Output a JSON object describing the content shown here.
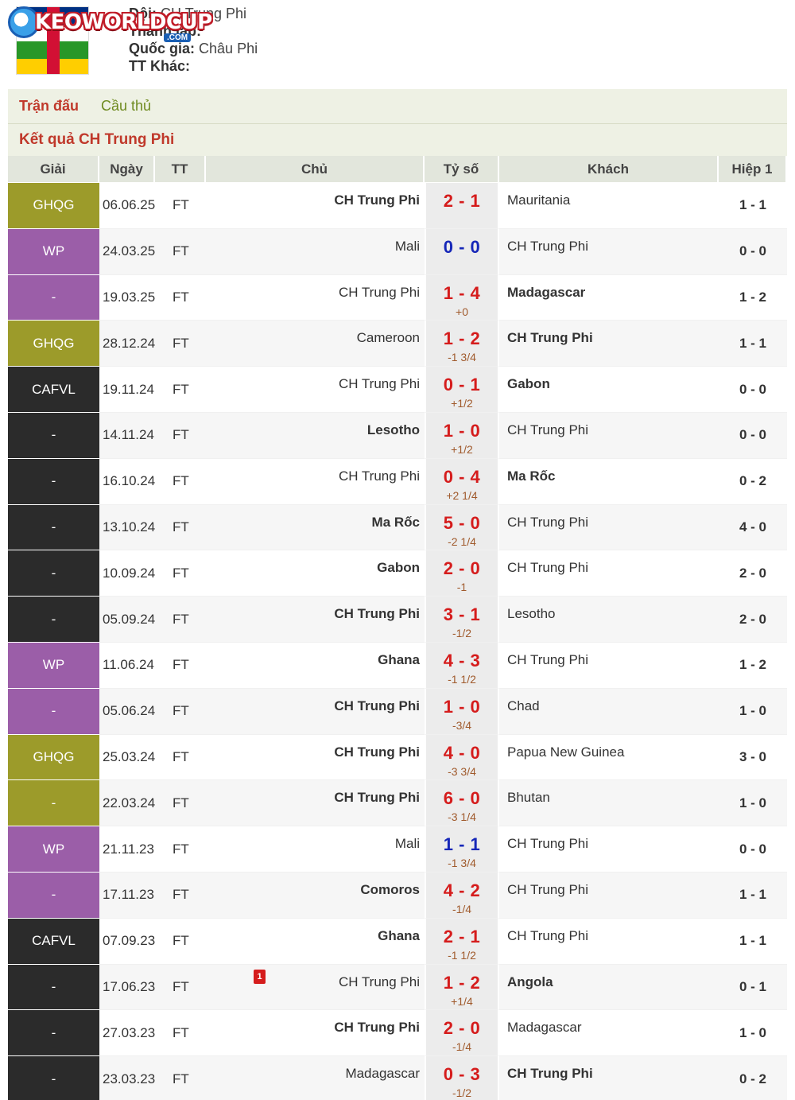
{
  "colors": {
    "league_ghqg": "#9c9b2a",
    "league_wp": "#9b5ea8",
    "league_cafvl": "#2b2b2b",
    "score_red": "#d51c1c",
    "score_blue": "#1627b8"
  },
  "header": {
    "logo_text": "KEOWORLDCUP",
    "logo_suffix": ".COM",
    "info": [
      {
        "label": "Đội:",
        "value": "CH Trung Phi"
      },
      {
        "label": "Thành lập:",
        "value": ""
      },
      {
        "label": "Quốc gia:",
        "value": "Châu Phi"
      },
      {
        "label": "TT Khác:",
        "value": ""
      }
    ]
  },
  "tabs": [
    {
      "label": "Trận đấu",
      "active": true
    },
    {
      "label": "Cầu thủ",
      "active": false
    }
  ],
  "section_title": "Kết quả CH Trung Phi",
  "table": {
    "headers": [
      "Giải",
      "Ngày",
      "TT",
      "Chủ",
      "Tỷ số",
      "Khách",
      "Hiệp 1"
    ],
    "rows": [
      {
        "league": "GHQG",
        "lc": "league_ghqg",
        "date": "06.06.25",
        "tt": "FT",
        "home": "CH Trung Phi",
        "hb": true,
        "score": "2 - 1",
        "sc": "red",
        "hc": "",
        "away": "Mauritania",
        "ab": false,
        "ht": "1 - 1"
      },
      {
        "league": "WP",
        "lc": "league_wp",
        "date": "24.03.25",
        "tt": "FT",
        "home": "Mali",
        "hb": false,
        "score": "0 - 0",
        "sc": "blue",
        "hc": "",
        "away": "CH Trung Phi",
        "ab": false,
        "ht": "0 - 0"
      },
      {
        "league": "-",
        "lc": "league_wp",
        "date": "19.03.25",
        "tt": "FT",
        "home": "CH Trung Phi",
        "hb": false,
        "score": "1 - 4",
        "sc": "red",
        "hc": "+0",
        "away": "Madagascar",
        "ab": true,
        "ht": "1 - 2"
      },
      {
        "league": "GHQG",
        "lc": "league_ghqg",
        "date": "28.12.24",
        "tt": "FT",
        "home": "Cameroon",
        "hb": false,
        "score": "1 - 2",
        "sc": "red",
        "hc": "-1 3/4",
        "away": "CH Trung Phi",
        "ab": true,
        "ht": "1 - 1"
      },
      {
        "league": "CAFVL",
        "lc": "league_cafvl",
        "date": "19.11.24",
        "tt": "FT",
        "home": "CH Trung Phi",
        "hb": false,
        "score": "0 - 1",
        "sc": "red",
        "hc": "+1/2",
        "away": "Gabon",
        "ab": true,
        "ht": "0 - 0"
      },
      {
        "league": "-",
        "lc": "league_cafvl",
        "date": "14.11.24",
        "tt": "FT",
        "home": "Lesotho",
        "hb": true,
        "score": "1 - 0",
        "sc": "red",
        "hc": "+1/2",
        "away": "CH Trung Phi",
        "ab": false,
        "ht": "0 - 0"
      },
      {
        "league": "-",
        "lc": "league_cafvl",
        "date": "16.10.24",
        "tt": "FT",
        "home": "CH Trung Phi",
        "hb": false,
        "score": "0 - 4",
        "sc": "red",
        "hc": "+2 1/4",
        "away": "Ma Rốc",
        "ab": true,
        "ht": "0 - 2"
      },
      {
        "league": "-",
        "lc": "league_cafvl",
        "date": "13.10.24",
        "tt": "FT",
        "home": "Ma Rốc",
        "hb": true,
        "score": "5 - 0",
        "sc": "red",
        "hc": "-2 1/4",
        "away": "CH Trung Phi",
        "ab": false,
        "ht": "4 - 0"
      },
      {
        "league": "-",
        "lc": "league_cafvl",
        "date": "10.09.24",
        "tt": "FT",
        "home": "Gabon",
        "hb": true,
        "score": "2 - 0",
        "sc": "red",
        "hc": "-1",
        "away": "CH Trung Phi",
        "ab": false,
        "ht": "2 - 0"
      },
      {
        "league": "-",
        "lc": "league_cafvl",
        "date": "05.09.24",
        "tt": "FT",
        "home": "CH Trung Phi",
        "hb": true,
        "score": "3 - 1",
        "sc": "red",
        "hc": "-1/2",
        "away": "Lesotho",
        "ab": false,
        "ht": "2 - 0"
      },
      {
        "league": "WP",
        "lc": "league_wp",
        "date": "11.06.24",
        "tt": "FT",
        "home": "Ghana",
        "hb": true,
        "score": "4 - 3",
        "sc": "red",
        "hc": "-1 1/2",
        "away": "CH Trung Phi",
        "ab": false,
        "ht": "1 - 2"
      },
      {
        "league": "-",
        "lc": "league_wp",
        "date": "05.06.24",
        "tt": "FT",
        "home": "CH Trung Phi",
        "hb": true,
        "score": "1 - 0",
        "sc": "red",
        "hc": "-3/4",
        "away": "Chad",
        "ab": false,
        "ht": "1 - 0"
      },
      {
        "league": "GHQG",
        "lc": "league_ghqg",
        "date": "25.03.24",
        "tt": "FT",
        "home": "CH Trung Phi",
        "hb": true,
        "score": "4 - 0",
        "sc": "red",
        "hc": "-3 3/4",
        "away": "Papua New Guinea",
        "ab": false,
        "ht": "3 - 0"
      },
      {
        "league": "-",
        "lc": "league_ghqg",
        "date": "22.03.24",
        "tt": "FT",
        "home": "CH Trung Phi",
        "hb": true,
        "score": "6 - 0",
        "sc": "red",
        "hc": "-3 1/4",
        "away": "Bhutan",
        "ab": false,
        "ht": "1 - 0"
      },
      {
        "league": "WP",
        "lc": "league_wp",
        "date": "21.11.23",
        "tt": "FT",
        "home": "Mali",
        "hb": false,
        "score": "1 - 1",
        "sc": "blue",
        "hc": "-1 3/4",
        "away": "CH Trung Phi",
        "ab": false,
        "ht": "0 - 0"
      },
      {
        "league": "-",
        "lc": "league_wp",
        "date": "17.11.23",
        "tt": "FT",
        "home": "Comoros",
        "hb": true,
        "score": "4 - 2",
        "sc": "red",
        "hc": "-1/4",
        "away": "CH Trung Phi",
        "ab": false,
        "ht": "1 - 1"
      },
      {
        "league": "CAFVL",
        "lc": "league_cafvl",
        "date": "07.09.23",
        "tt": "FT",
        "home": "Ghana",
        "hb": true,
        "score": "2 - 1",
        "sc": "red",
        "hc": "-1 1/2",
        "away": "CH Trung Phi",
        "ab": false,
        "ht": "1 - 1"
      },
      {
        "league": "-",
        "lc": "league_cafvl",
        "date": "17.06.23",
        "tt": "FT",
        "home": "CH Trung Phi",
        "hb": false,
        "card": "1",
        "score": "1 - 2",
        "sc": "red",
        "hc": "+1/4",
        "away": "Angola",
        "ab": true,
        "ht": "0 - 1"
      },
      {
        "league": "-",
        "lc": "league_cafvl",
        "date": "27.03.23",
        "tt": "FT",
        "home": "CH Trung Phi",
        "hb": true,
        "score": "2 - 0",
        "sc": "red",
        "hc": "-1/4",
        "away": "Madagascar",
        "ab": false,
        "ht": "1 - 0"
      },
      {
        "league": "-",
        "lc": "league_cafvl",
        "date": "23.03.23",
        "tt": "FT",
        "home": "Madagascar",
        "hb": false,
        "score": "0 - 3",
        "sc": "red",
        "hc": "-1/2",
        "away": "CH Trung Phi",
        "ab": true,
        "ht": "0 - 2"
      }
    ]
  }
}
